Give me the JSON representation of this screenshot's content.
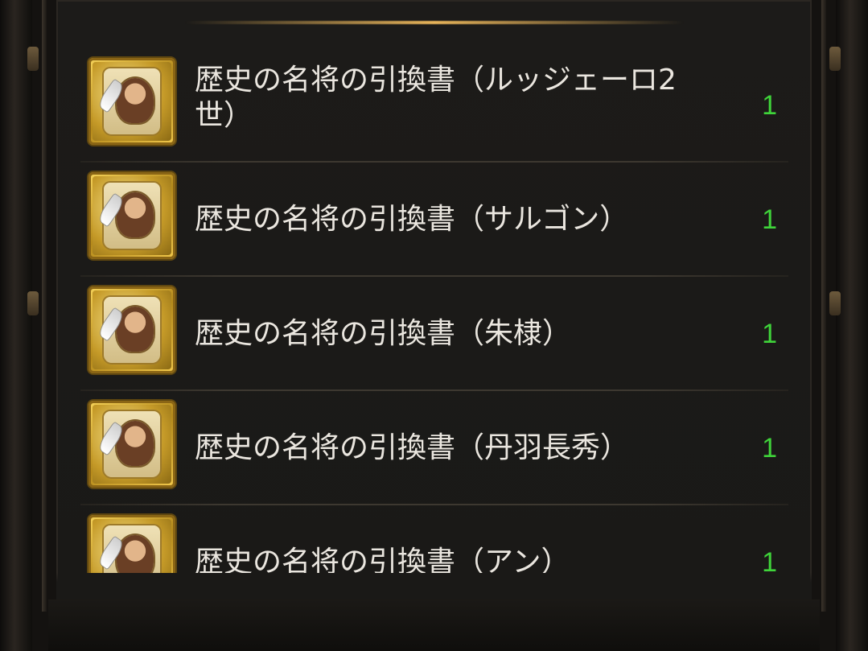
{
  "items": [
    {
      "name": "歴史の名将の引換書（ルッジェーロ2世）",
      "count": "1",
      "icon": "scroll-portrait-icon"
    },
    {
      "name": "歴史の名将の引換書（サルゴン）",
      "count": "1",
      "icon": "scroll-portrait-icon"
    },
    {
      "name": "歴史の名将の引換書（朱棣）",
      "count": "1",
      "icon": "scroll-portrait-icon"
    },
    {
      "name": "歴史の名将の引換書（丹羽長秀）",
      "count": "1",
      "icon": "scroll-portrait-icon"
    },
    {
      "name": "歴史の名将の引換書（アン）",
      "count": "1",
      "icon": "scroll-portrait-icon"
    }
  ],
  "colors": {
    "count": "#3fd43a",
    "text": "#eae6df",
    "gold": "#e7b45a",
    "background": "#1b1a18"
  }
}
